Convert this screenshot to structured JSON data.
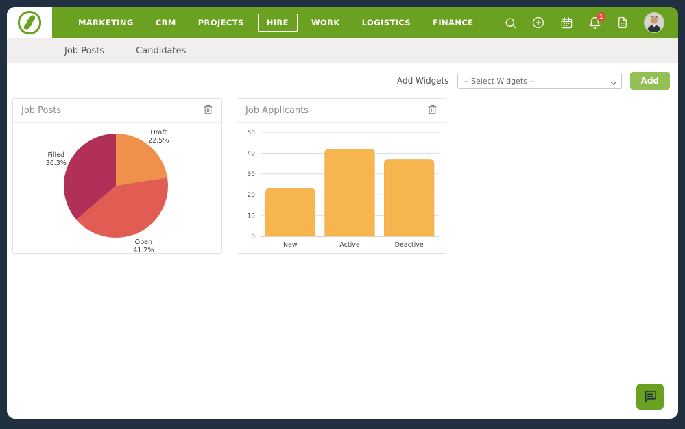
{
  "frame": {
    "background": "#203040"
  },
  "header": {
    "background": "#6aa121",
    "nav": [
      "MARKETING",
      "CRM",
      "PROJECTS",
      "HIRE",
      "WORK",
      "LOGISTICS",
      "FINANCE"
    ],
    "active_nav": "HIRE",
    "notification_badge": "1"
  },
  "subnav": {
    "items": [
      "Job Posts",
      "Candidates"
    ]
  },
  "toolbar": {
    "add_widgets_label": "Add Widgets",
    "select_placeholder": "-- Select Widgets --",
    "add_button_label": "Add"
  },
  "accent": {
    "nav_green": "#6aa121",
    "button_green": "#94bf55",
    "badge_red": "#e8443a"
  },
  "chart_data": [
    {
      "type": "pie",
      "title": "Job Posts",
      "labels": [
        "Draft",
        "Open",
        "Filled"
      ],
      "values": [
        22.5,
        41.2,
        36.3
      ],
      "value_suffix": "%",
      "colors": [
        "#ef914b",
        "#e15c52",
        "#b13058"
      ],
      "legend_position": "outside-labels"
    },
    {
      "type": "bar",
      "title": "Job Applicants",
      "categories": [
        "New",
        "Active",
        "Deactive"
      ],
      "values": [
        23,
        42,
        37
      ],
      "bar_color": "#f6b54e",
      "bar_edge_color": "#efa63e",
      "ylim": [
        0,
        50
      ],
      "yticks": [
        0,
        10,
        20,
        30,
        40,
        50
      ],
      "grid": true
    }
  ]
}
